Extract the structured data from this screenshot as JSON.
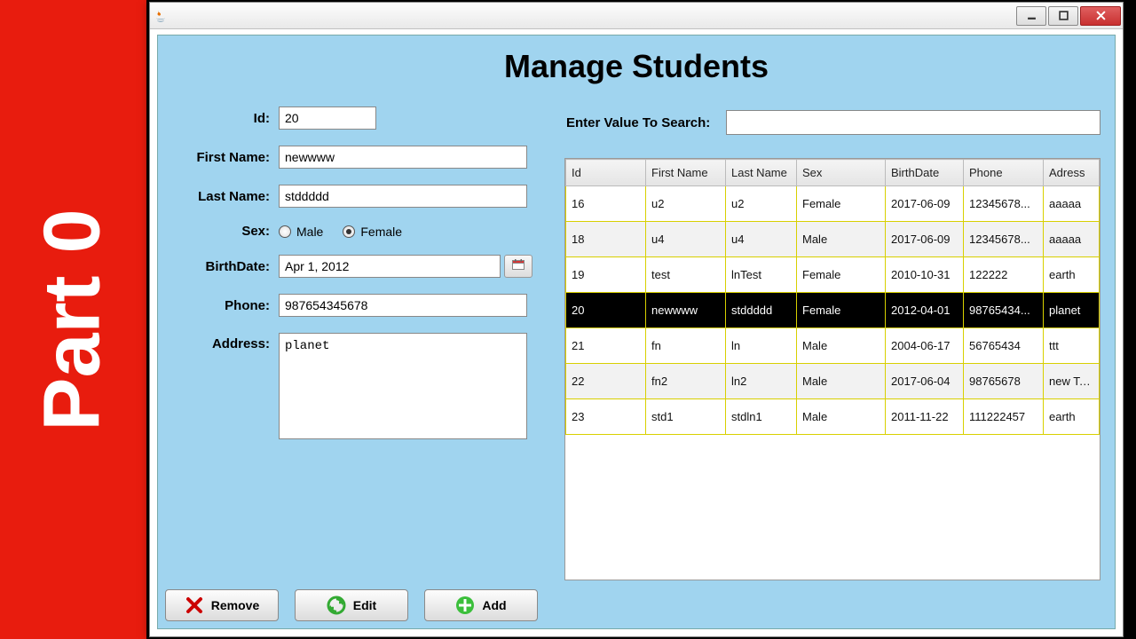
{
  "banner": {
    "text": "Part 0"
  },
  "window": {
    "title": "",
    "buttons": {
      "minimize": "min",
      "maximize": "max",
      "close": "close"
    }
  },
  "page": {
    "title": "Manage Students"
  },
  "form": {
    "labels": {
      "id": "Id:",
      "first_name": "First Name:",
      "last_name": "Last Name:",
      "sex": "Sex:",
      "birthdate": "BirthDate:",
      "phone": "Phone:",
      "address": "Address:"
    },
    "values": {
      "id": "20",
      "first_name": "newwww",
      "last_name": "stddddd",
      "birthdate": "Apr 1, 2012",
      "phone": "987654345678",
      "address": "planet"
    },
    "sex": {
      "options": {
        "male": "Male",
        "female": "Female"
      },
      "selected": "female"
    }
  },
  "search": {
    "label": "Enter Value To Search:",
    "value": ""
  },
  "table": {
    "columns": [
      "Id",
      "First Name",
      "Last Name",
      "Sex",
      "BirthDate",
      "Phone",
      "Adress"
    ],
    "selected_id": "20",
    "rows": [
      {
        "id": "16",
        "fn": "u2",
        "ln": "u2",
        "sex": "Female",
        "bd": "2017-06-09",
        "ph": "12345678...",
        "ad": "aaaaa"
      },
      {
        "id": "18",
        "fn": "u4",
        "ln": "u4",
        "sex": "Male",
        "bd": "2017-06-09",
        "ph": "12345678...",
        "ad": "aaaaa"
      },
      {
        "id": "19",
        "fn": "test",
        "ln": "lnTest",
        "sex": "Female",
        "bd": "2010-10-31",
        "ph": "122222",
        "ad": "earth"
      },
      {
        "id": "20",
        "fn": "newwww",
        "ln": "stddddd",
        "sex": "Female",
        "bd": "2012-04-01",
        "ph": "98765434...",
        "ad": "planet"
      },
      {
        "id": "21",
        "fn": "fn",
        "ln": "ln",
        "sex": "Male",
        "bd": "2004-06-17",
        "ph": "56765434",
        "ad": "ttt"
      },
      {
        "id": "22",
        "fn": "fn2",
        "ln": "ln2",
        "sex": "Male",
        "bd": "2017-06-04",
        "ph": "98765678",
        "ad": "new Test"
      },
      {
        "id": "23",
        "fn": "std1",
        "ln": "stdln1",
        "sex": "Male",
        "bd": "2011-11-22",
        "ph": "111222457",
        "ad": "earth"
      }
    ]
  },
  "buttons": {
    "remove": "Remove",
    "edit": "Edit",
    "add": "Add"
  }
}
